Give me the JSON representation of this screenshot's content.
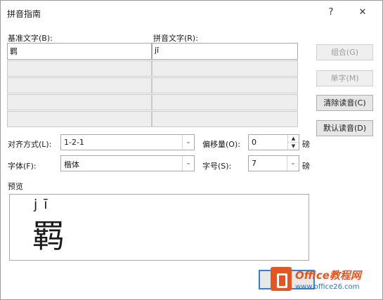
{
  "dialog": {
    "title": "拼音指南",
    "help_icon": "?",
    "close_icon": "✕"
  },
  "base_text": {
    "label": "基准文字(B):",
    "rows": [
      "羁",
      "",
      "",
      "",
      ""
    ]
  },
  "ruby_text": {
    "label": "拼音文字(R):",
    "rows": [
      "jī",
      "",
      "",
      "",
      ""
    ]
  },
  "buttons": {
    "group": "组合(G)",
    "single": "单字(M)",
    "clear": "清除读音(C)",
    "default": "默认读音(D)"
  },
  "alignment": {
    "label": "对齐方式(L):",
    "value": "1-2-1"
  },
  "offset": {
    "label": "偏移量(O):",
    "value": "0",
    "unit": "磅"
  },
  "font": {
    "label": "字体(F):",
    "value": "楷体"
  },
  "size": {
    "label": "字号(S):",
    "value": "7",
    "unit": "磅"
  },
  "preview": {
    "label": "预览",
    "pinyin": "jī",
    "character": "羁"
  },
  "watermark": {
    "brand": "Office教程网",
    "url": "www.office26.com"
  }
}
